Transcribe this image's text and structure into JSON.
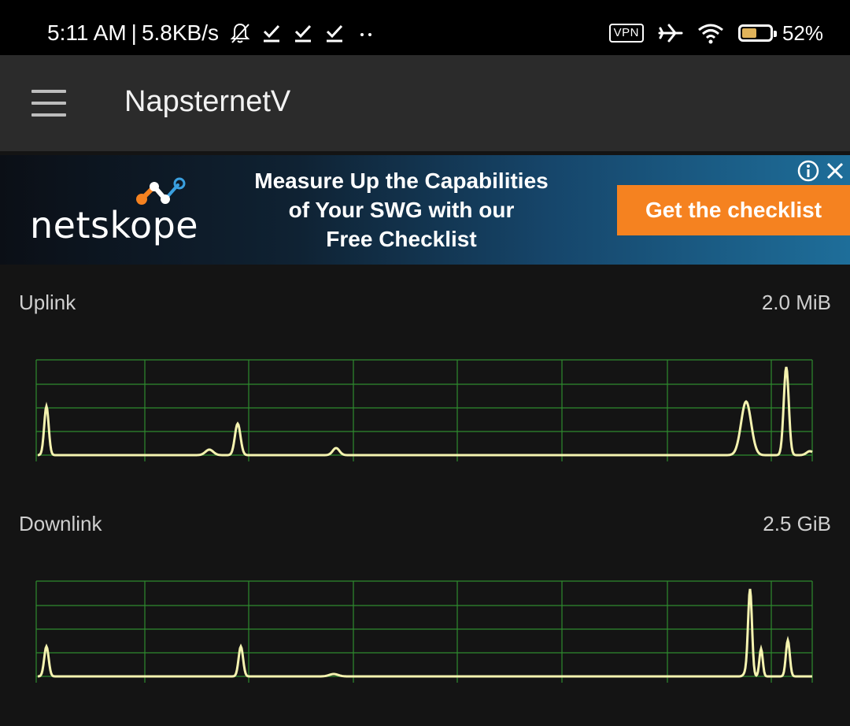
{
  "status_bar": {
    "time": "5:11 AM",
    "separator": "|",
    "speed": "5.8KB/s",
    "vpn_label": "VPN",
    "battery_percent": "52%",
    "battery_level": 0.52
  },
  "app_bar": {
    "title": "NapsternetV"
  },
  "ad": {
    "brand": "netskope",
    "headline_line1": "Measure Up the Capabilities",
    "headline_line2": "of Your SWG with our",
    "headline_line3": "Free Checklist",
    "cta": "Get the checklist",
    "colors": {
      "cta": "#f58220"
    }
  },
  "uplink": {
    "label": "Uplink",
    "value": "2.0 MiB"
  },
  "downlink": {
    "label": "Downlink",
    "value": "2.5 GiB"
  },
  "colors": {
    "grid": "#2e8b2e",
    "trace": "#f5f3b0"
  }
}
